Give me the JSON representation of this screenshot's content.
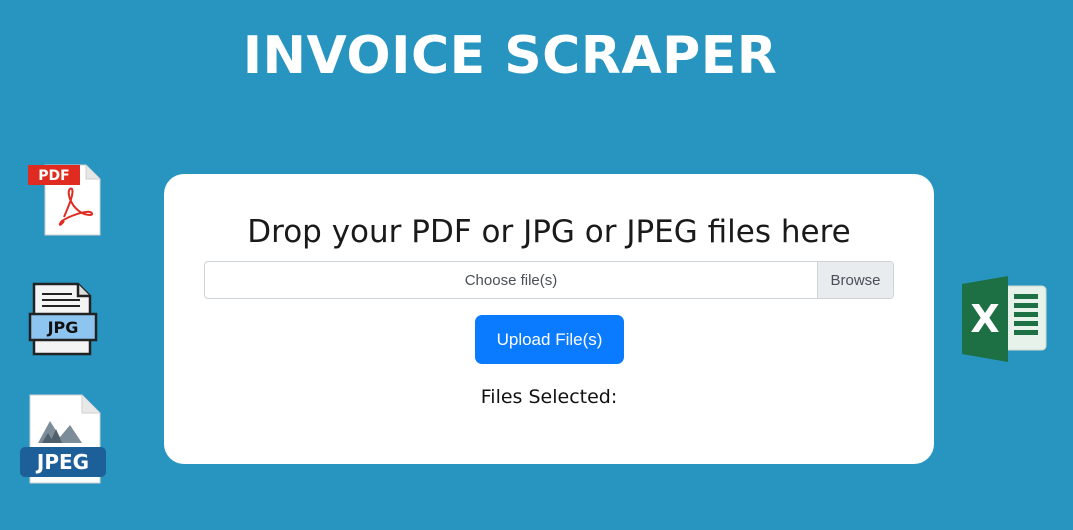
{
  "header": {
    "title": "INVOICE SCRAPER"
  },
  "upload_card": {
    "heading": "Drop your PDF or JPG or JPEG files here",
    "file_input": {
      "placeholder": "Choose file(s)",
      "browse_label": "Browse"
    },
    "upload_button_label": "Upload File(s)",
    "files_selected_label": "Files Selected:"
  },
  "icons": {
    "pdf": {
      "name": "pdf-file-icon",
      "badge": "PDF",
      "badge_color": "#e02b20"
    },
    "jpg": {
      "name": "jpg-file-icon",
      "badge": "JPG",
      "badge_color": "#8ec5f0"
    },
    "jpeg": {
      "name": "jpeg-file-icon",
      "badge": "JPEG",
      "badge_color": "#1d5f99"
    },
    "excel": {
      "name": "excel-icon",
      "letter": "X",
      "color": "#1d7043"
    }
  },
  "colors": {
    "background": "#2795c0",
    "card": "#ffffff",
    "primary_button": "#0a7bff"
  }
}
